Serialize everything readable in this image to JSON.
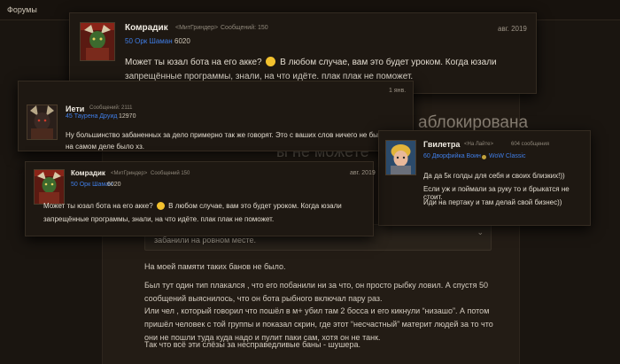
{
  "topbar": {
    "title": "Форумы"
  },
  "background": {
    "banned_text": "аблокирована",
    "cannot_text": "ы не можете",
    "quote": "забанили на ровном месте.",
    "paragraphs": [
      "На моей памяти таких банов не было.",
      "Был тут один тип плакался , что его побанили ни за что, он просто рыбку ловил. А спустя 50 сообщений выяснилось, что он бота рыбного включал пару раз.",
      "Или чел , который говорил что пошёл в м+ убил там 2 босса и его кикнули “низашо”. А потом пришёл человек с той группы и показал скрин, где этот “несчастный” материт людей за то что они не пошли туда куда надо и пулит паки сам, хотя он не танк.",
      "Так что всё эти слёзы за несправедливые баны - шушера."
    ]
  },
  "posts": [
    {
      "name": "Комрадик",
      "guild": "<МитГриндер>",
      "posts": "Сообщений: 150",
      "class": "50 Орк Шаман",
      "score": "6020",
      "date": "авг. 2019",
      "text_1": "Может ты юзал бота на его акке?",
      "text_2": "В любом случае, вам это будет уроком. Когда юзали запрещённые программы, знали, на что идёте. плак плак не поможет."
    },
    {
      "name": "Иети",
      "posts": "Сообщений: 2111",
      "class": "45 Таурена Друид",
      "score": "12970",
      "date": "1 янв.",
      "text": "Ну большинство забаненных за дело примерно так же говорят. Это с ваших слов ничего не было, как на самом деле было хз."
    },
    {
      "name": "Гвилетра",
      "guild": "<На Лайте>",
      "posts": "604 сообщения",
      "class": "60 Дворфийка Воин",
      "realm": "WoW Classic",
      "text_1": "Да да 5к голды для себя и своих близких!))",
      "text_2": "Если уж и поймали за руку то и брыкатся не стоит.",
      "text_3": "Иди на пертаку и там делай свой бизнес))"
    },
    {
      "name": "Комрадик",
      "guild": "<МитГриндер>",
      "posts": "Сообщений 150",
      "class": "50 Орк Шаман",
      "score": "6020",
      "date": "авг. 2019",
      "text_1": "Может ты юзал бота на его акке?",
      "text_2": "В любом случае, вам это будет уроком. Когда юзали запрещённые программы, знали, на что идёте. плак плак не поможет."
    }
  ],
  "colors": {
    "class_blue": "#3f7de6",
    "background": "#1a1510",
    "card": "#1e1812",
    "smile": "#f2c12e"
  }
}
